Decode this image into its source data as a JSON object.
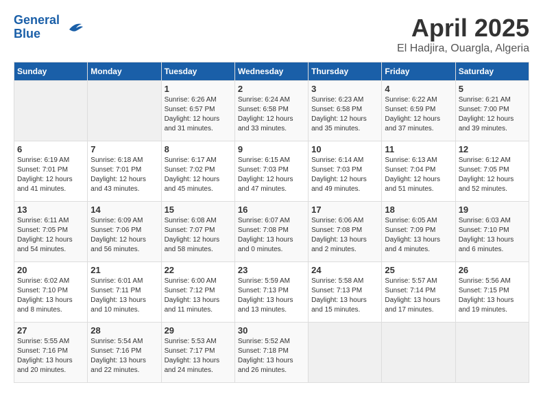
{
  "header": {
    "logo_line1": "General",
    "logo_line2": "Blue",
    "month": "April 2025",
    "location": "El Hadjira, Ouargla, Algeria"
  },
  "days_of_week": [
    "Sunday",
    "Monday",
    "Tuesday",
    "Wednesday",
    "Thursday",
    "Friday",
    "Saturday"
  ],
  "weeks": [
    [
      {
        "day": "",
        "info": ""
      },
      {
        "day": "",
        "info": ""
      },
      {
        "day": "1",
        "info": "Sunrise: 6:26 AM\nSunset: 6:57 PM\nDaylight: 12 hours\nand 31 minutes."
      },
      {
        "day": "2",
        "info": "Sunrise: 6:24 AM\nSunset: 6:58 PM\nDaylight: 12 hours\nand 33 minutes."
      },
      {
        "day": "3",
        "info": "Sunrise: 6:23 AM\nSunset: 6:58 PM\nDaylight: 12 hours\nand 35 minutes."
      },
      {
        "day": "4",
        "info": "Sunrise: 6:22 AM\nSunset: 6:59 PM\nDaylight: 12 hours\nand 37 minutes."
      },
      {
        "day": "5",
        "info": "Sunrise: 6:21 AM\nSunset: 7:00 PM\nDaylight: 12 hours\nand 39 minutes."
      }
    ],
    [
      {
        "day": "6",
        "info": "Sunrise: 6:19 AM\nSunset: 7:01 PM\nDaylight: 12 hours\nand 41 minutes."
      },
      {
        "day": "7",
        "info": "Sunrise: 6:18 AM\nSunset: 7:01 PM\nDaylight: 12 hours\nand 43 minutes."
      },
      {
        "day": "8",
        "info": "Sunrise: 6:17 AM\nSunset: 7:02 PM\nDaylight: 12 hours\nand 45 minutes."
      },
      {
        "day": "9",
        "info": "Sunrise: 6:15 AM\nSunset: 7:03 PM\nDaylight: 12 hours\nand 47 minutes."
      },
      {
        "day": "10",
        "info": "Sunrise: 6:14 AM\nSunset: 7:03 PM\nDaylight: 12 hours\nand 49 minutes."
      },
      {
        "day": "11",
        "info": "Sunrise: 6:13 AM\nSunset: 7:04 PM\nDaylight: 12 hours\nand 51 minutes."
      },
      {
        "day": "12",
        "info": "Sunrise: 6:12 AM\nSunset: 7:05 PM\nDaylight: 12 hours\nand 52 minutes."
      }
    ],
    [
      {
        "day": "13",
        "info": "Sunrise: 6:11 AM\nSunset: 7:05 PM\nDaylight: 12 hours\nand 54 minutes."
      },
      {
        "day": "14",
        "info": "Sunrise: 6:09 AM\nSunset: 7:06 PM\nDaylight: 12 hours\nand 56 minutes."
      },
      {
        "day": "15",
        "info": "Sunrise: 6:08 AM\nSunset: 7:07 PM\nDaylight: 12 hours\nand 58 minutes."
      },
      {
        "day": "16",
        "info": "Sunrise: 6:07 AM\nSunset: 7:08 PM\nDaylight: 13 hours\nand 0 minutes."
      },
      {
        "day": "17",
        "info": "Sunrise: 6:06 AM\nSunset: 7:08 PM\nDaylight: 13 hours\nand 2 minutes."
      },
      {
        "day": "18",
        "info": "Sunrise: 6:05 AM\nSunset: 7:09 PM\nDaylight: 13 hours\nand 4 minutes."
      },
      {
        "day": "19",
        "info": "Sunrise: 6:03 AM\nSunset: 7:10 PM\nDaylight: 13 hours\nand 6 minutes."
      }
    ],
    [
      {
        "day": "20",
        "info": "Sunrise: 6:02 AM\nSunset: 7:10 PM\nDaylight: 13 hours\nand 8 minutes."
      },
      {
        "day": "21",
        "info": "Sunrise: 6:01 AM\nSunset: 7:11 PM\nDaylight: 13 hours\nand 10 minutes."
      },
      {
        "day": "22",
        "info": "Sunrise: 6:00 AM\nSunset: 7:12 PM\nDaylight: 13 hours\nand 11 minutes."
      },
      {
        "day": "23",
        "info": "Sunrise: 5:59 AM\nSunset: 7:13 PM\nDaylight: 13 hours\nand 13 minutes."
      },
      {
        "day": "24",
        "info": "Sunrise: 5:58 AM\nSunset: 7:13 PM\nDaylight: 13 hours\nand 15 minutes."
      },
      {
        "day": "25",
        "info": "Sunrise: 5:57 AM\nSunset: 7:14 PM\nDaylight: 13 hours\nand 17 minutes."
      },
      {
        "day": "26",
        "info": "Sunrise: 5:56 AM\nSunset: 7:15 PM\nDaylight: 13 hours\nand 19 minutes."
      }
    ],
    [
      {
        "day": "27",
        "info": "Sunrise: 5:55 AM\nSunset: 7:16 PM\nDaylight: 13 hours\nand 20 minutes."
      },
      {
        "day": "28",
        "info": "Sunrise: 5:54 AM\nSunset: 7:16 PM\nDaylight: 13 hours\nand 22 minutes."
      },
      {
        "day": "29",
        "info": "Sunrise: 5:53 AM\nSunset: 7:17 PM\nDaylight: 13 hours\nand 24 minutes."
      },
      {
        "day": "30",
        "info": "Sunrise: 5:52 AM\nSunset: 7:18 PM\nDaylight: 13 hours\nand 26 minutes."
      },
      {
        "day": "",
        "info": ""
      },
      {
        "day": "",
        "info": ""
      },
      {
        "day": "",
        "info": ""
      }
    ]
  ]
}
